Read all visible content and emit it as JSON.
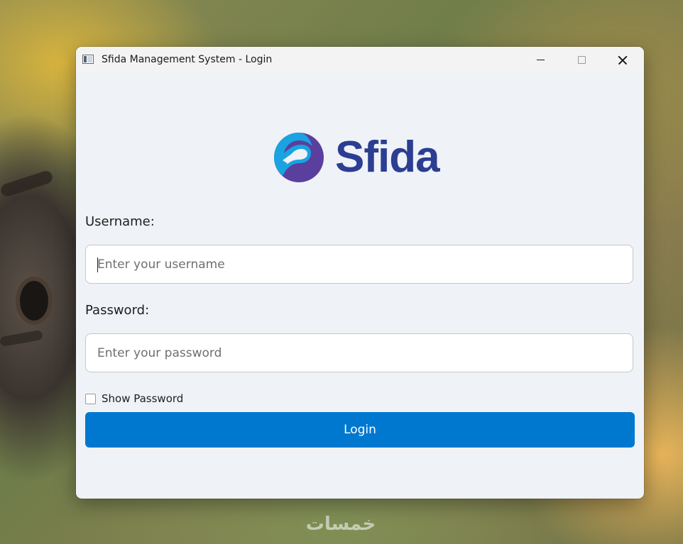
{
  "window": {
    "title": "Sfida Management System - Login"
  },
  "logo": {
    "text": "Sfida",
    "colors": {
      "text": "#2b3e91",
      "mark_blue": "#1aa3e0",
      "mark_purple": "#5a3f9e"
    }
  },
  "form": {
    "username_label": "Username:",
    "username_placeholder": "Enter your username",
    "username_value": "",
    "password_label": "Password:",
    "password_placeholder": "Enter your password",
    "password_value": "",
    "show_password_label": "Show Password",
    "show_password_checked": false,
    "login_label": "Login"
  },
  "watermark": {
    "text": "خمسات"
  },
  "colors": {
    "accent": "#0078d0",
    "window_bg": "#eff2f7"
  }
}
